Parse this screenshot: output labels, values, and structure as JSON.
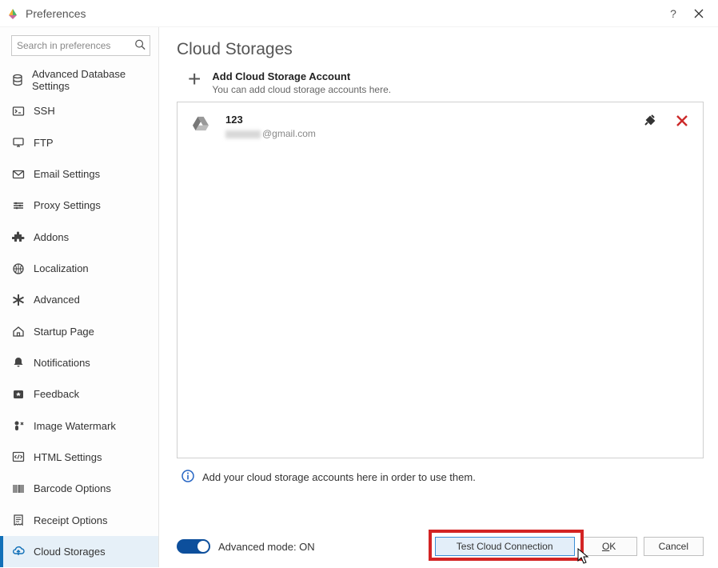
{
  "window": {
    "title": "Preferences"
  },
  "search": {
    "placeholder": "Search in preferences"
  },
  "sidebar": {
    "items": [
      {
        "label": "Advanced Database Settings",
        "selected": false
      },
      {
        "label": "SSH",
        "selected": false
      },
      {
        "label": "FTP",
        "selected": false
      },
      {
        "label": "Email Settings",
        "selected": false
      },
      {
        "label": "Proxy Settings",
        "selected": false
      },
      {
        "label": "Addons",
        "selected": false
      },
      {
        "label": "Localization",
        "selected": false
      },
      {
        "label": "Advanced",
        "selected": false
      },
      {
        "label": "Startup Page",
        "selected": false
      },
      {
        "label": "Notifications",
        "selected": false
      },
      {
        "label": "Feedback",
        "selected": false
      },
      {
        "label": "Image Watermark",
        "selected": false
      },
      {
        "label": "HTML Settings",
        "selected": false
      },
      {
        "label": "Barcode Options",
        "selected": false
      },
      {
        "label": "Receipt Options",
        "selected": false
      },
      {
        "label": "Cloud Storages",
        "selected": true
      }
    ]
  },
  "page": {
    "title": "Cloud Storages",
    "add": {
      "title": "Add Cloud Storage Account",
      "subtitle": "You can add cloud storage accounts here."
    },
    "accounts": [
      {
        "name": "123",
        "email_suffix": "@gmail.com"
      }
    ],
    "info": "Add your cloud storage accounts here in order to use them."
  },
  "footer": {
    "toggle_label": "Advanced mode: ON",
    "toggle_on": true,
    "buttons": {
      "test": "Test Cloud Connection",
      "ok": "OK",
      "cancel": "Cancel"
    }
  }
}
